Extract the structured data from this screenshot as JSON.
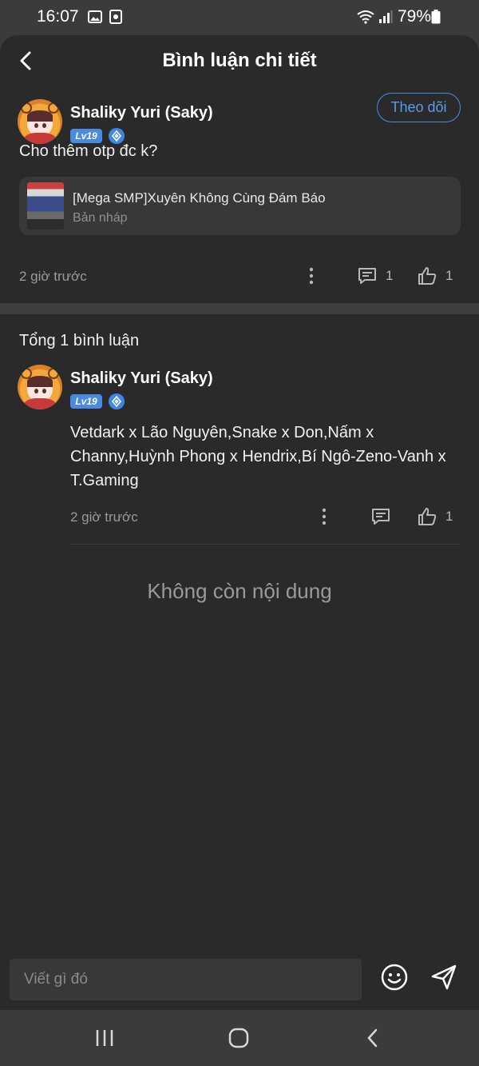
{
  "status_bar": {
    "time": "16:07",
    "battery": "79%",
    "left_icons": [
      "gallery-icon",
      "screen-record-icon"
    ],
    "right_icons": [
      "wifi-icon",
      "signal-icon",
      "battery-icon"
    ]
  },
  "header": {
    "title": "Bình luận chi tiết",
    "back_icon": "back-arrow-icon"
  },
  "post": {
    "author": "Shaliky Yuri (Saky)",
    "level_badge": "Lv19",
    "follow_label": "Theo dõi",
    "text": "Cho thêm otp đc k?",
    "attachment": {
      "title": "[Mega SMP]Xuyên Không Cùng Đám Báo",
      "subtitle": "Bản nháp"
    },
    "time": "2 giờ trước",
    "comment_count": "1",
    "like_count": "1"
  },
  "comments_section": {
    "total_label": "Tổng 1 bình luận",
    "comments": [
      {
        "author": "Shaliky Yuri (Saky)",
        "level_badge": "Lv19",
        "text": "Vetdark x Lão Nguyên,Snake x Don,Nấm x Channy,Huỳnh Phong x Hendrix,Bí Ngô-Zeno-Vanh x T.Gaming",
        "time": "2 giờ trước",
        "like_count": "1"
      }
    ],
    "end_message": "Không còn nội dung"
  },
  "composer": {
    "placeholder": "Viết gì đó"
  },
  "colors": {
    "background": "#2a2a2a",
    "accent": "#4a8be0",
    "card": "#383838"
  }
}
